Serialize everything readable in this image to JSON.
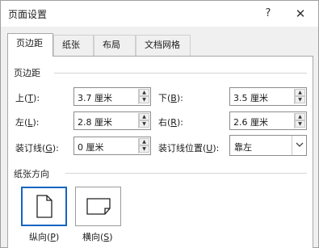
{
  "window": {
    "title": "页面设置",
    "help_label": "?",
    "close_label": "✕"
  },
  "tabs": [
    {
      "label": "页边距",
      "active": true
    },
    {
      "label": "纸张",
      "active": false
    },
    {
      "label": "布局",
      "active": false
    },
    {
      "label": "文档网格",
      "active": false
    }
  ],
  "margins": {
    "section_title": "页边距",
    "top": {
      "label": "上(",
      "key": "T",
      "end": "):",
      "value": "3.7 厘米"
    },
    "bottom": {
      "label": "下(",
      "key": "B",
      "end": "):",
      "value": "3.5 厘米"
    },
    "left": {
      "label": "左(",
      "key": "L",
      "end": "):",
      "value": "2.8 厘米"
    },
    "right": {
      "label": "右(",
      "key": "R",
      "end": "):",
      "value": "2.6 厘米"
    },
    "gutter": {
      "label": "装订线(",
      "key": "G",
      "end": "):",
      "value": "0 厘米"
    },
    "gutter_position": {
      "label": "装订线位置(",
      "key": "U",
      "end": "):",
      "value": "靠左"
    }
  },
  "orientation": {
    "section_title": "纸张方向",
    "portrait": {
      "label": "纵向(",
      "key": "P",
      "end": ")",
      "selected": true
    },
    "landscape": {
      "label": "横向(",
      "key": "S",
      "end": ")",
      "selected": false
    }
  },
  "icons": {
    "help": "help-icon",
    "close": "close-icon",
    "spin_up": "spin-up-icon",
    "spin_down": "spin-down-icon",
    "dropdown": "chevron-down-icon",
    "portrait": "portrait-page-icon",
    "landscape": "landscape-page-icon"
  },
  "colors": {
    "selection_border": "#1565c0"
  }
}
